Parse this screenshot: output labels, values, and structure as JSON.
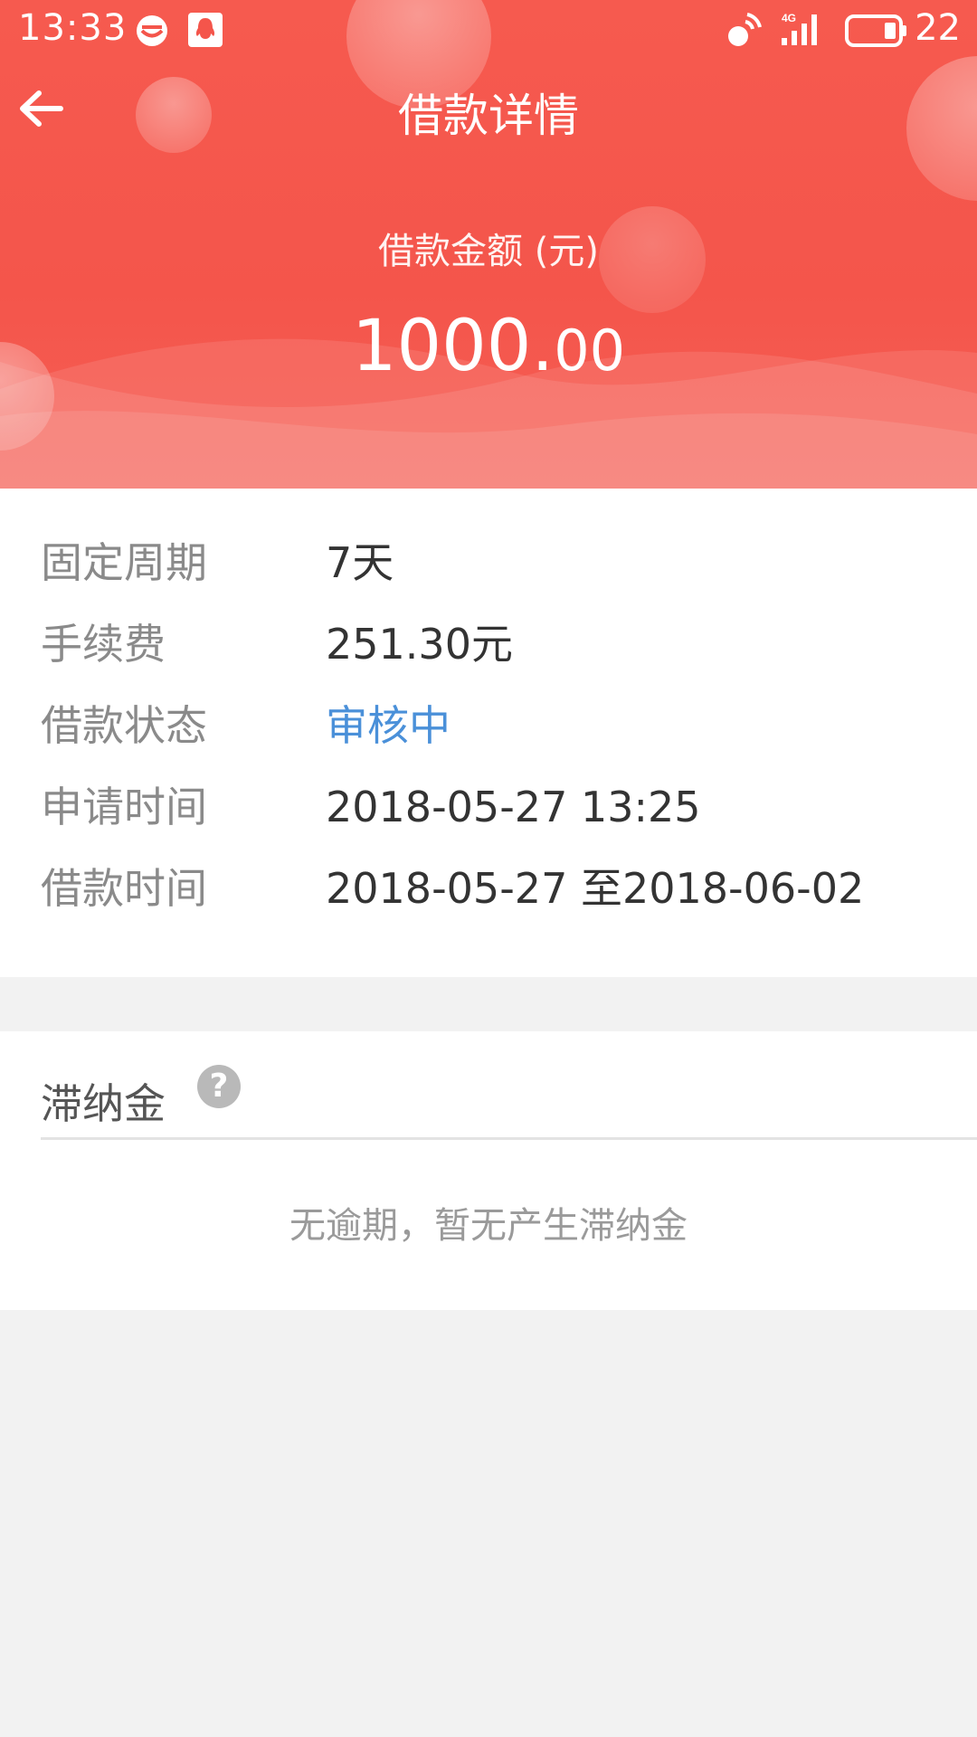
{
  "status_bar": {
    "time": "13:33",
    "network": "4G",
    "battery": "22",
    "icons": [
      "chat-bubble-icon",
      "qq-penguin-icon",
      "hotspot-icon",
      "signal-icon",
      "battery-icon"
    ]
  },
  "header": {
    "title": "借款详情",
    "back_icon": "arrow-left-icon",
    "amount_label": "借款金额 (元)",
    "amount_int": "1000.",
    "amount_dec": "00"
  },
  "details": {
    "rows": [
      {
        "label": "固定周期",
        "value": "7天"
      },
      {
        "label": "手续费",
        "value": "251.30元"
      },
      {
        "label": "借款状态",
        "value": "审核中"
      },
      {
        "label": "申请时间",
        "value": "2018-05-27 13:25"
      },
      {
        "label": "借款时间",
        "value": "2018-05-27 至2018-06-02"
      }
    ]
  },
  "late_fee": {
    "title": "滞纳金",
    "help_icon": "question-mark-icon",
    "help_glyph": "?",
    "empty_text": "无逾期，暂无产生滞纳金"
  },
  "colors": {
    "header_red": "#f4554b",
    "status_blue": "#4a90d9",
    "label_gray": "#8a8a8a",
    "value_dark": "#333333",
    "page_bg": "#f2f2f2"
  }
}
